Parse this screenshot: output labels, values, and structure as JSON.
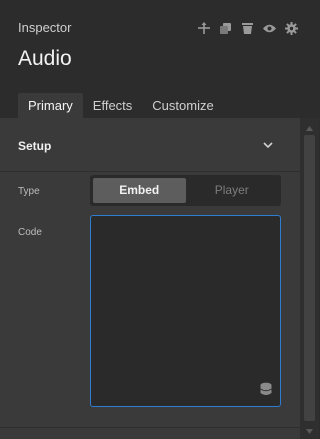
{
  "header": {
    "panel_label": "Inspector",
    "title": "Audio",
    "toolbar_icons": [
      "move-icon",
      "duplicate-icon",
      "delete-icon",
      "visibility-icon",
      "settings-icon"
    ]
  },
  "tabs": [
    {
      "label": "Primary",
      "active": true
    },
    {
      "label": "Effects",
      "active": false
    },
    {
      "label": "Customize",
      "active": false
    }
  ],
  "section": {
    "title": "Setup",
    "expanded": true
  },
  "fields": {
    "type_label": "Type",
    "type_options": [
      "Embed",
      "Player"
    ],
    "type_selected": "Embed",
    "code_label": "Code",
    "code_value": ""
  },
  "colors": {
    "background": "#2c2c2c",
    "panel": "#3a3a3a",
    "input": "#2a2a2a",
    "focus_border": "#2d7dd2",
    "segment_active": "#5d5d5d"
  }
}
